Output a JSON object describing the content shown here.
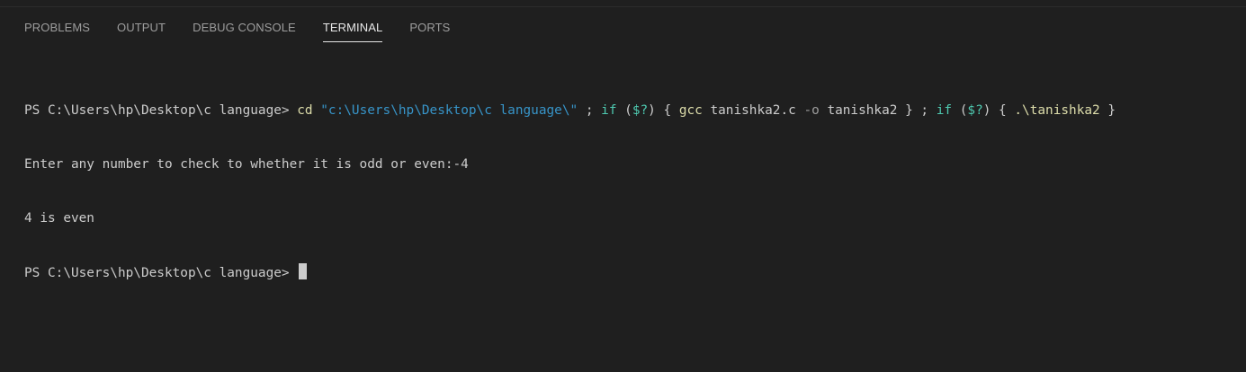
{
  "tabs": [
    {
      "label": "PROBLEMS",
      "active": false
    },
    {
      "label": "OUTPUT",
      "active": false
    },
    {
      "label": "DEBUG CONSOLE",
      "active": false
    },
    {
      "label": "TERMINAL",
      "active": true
    },
    {
      "label": "PORTS",
      "active": false
    }
  ],
  "terminal": {
    "line1": {
      "prompt": "PS C:\\Users\\hp\\Desktop\\c language> ",
      "cd": "cd",
      "sp1": " ",
      "path": "\"c:\\Users\\hp\\Desktop\\c language\\\"",
      "sep1": " ; ",
      "if1": "if",
      "open1": " (",
      "var1": "$?",
      "close1": ") { ",
      "gcc": "gcc",
      "gcc_args1": " tanishka2.c ",
      "flag": "-o",
      "gcc_args2": " tanishka2 } ; ",
      "if2": "if",
      "open2": " (",
      "var2": "$?",
      "close2": ") { ",
      "run": ".\\tanishka2",
      "end": " }"
    },
    "line2": "Enter any number to check to whether it is odd or even:-4",
    "line3": "4 is even",
    "line4_prompt": "PS C:\\Users\\hp\\Desktop\\c language> "
  },
  "colors": {
    "background": "#1f1f1f",
    "command": "#dcdcaa",
    "string": "#3794c8",
    "keyword": "#4ec9b0",
    "text": "#cccccc"
  }
}
